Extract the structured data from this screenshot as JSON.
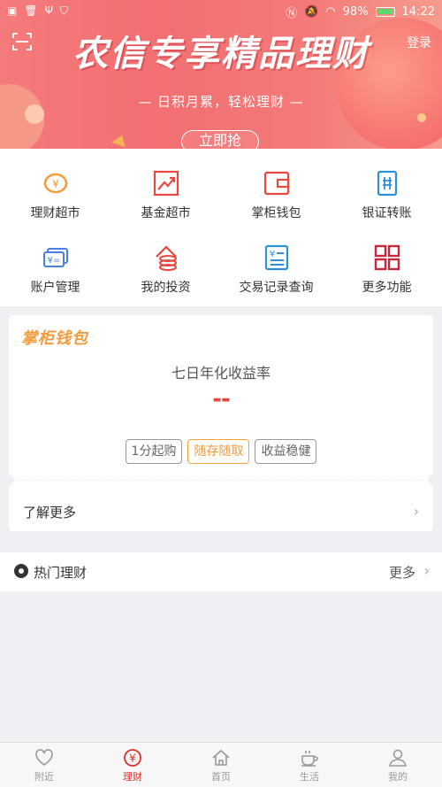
{
  "status": {
    "icons_left": [
      "notify-icon",
      "trash-icon",
      "usb-icon",
      "shield-icon"
    ],
    "battery": "98%",
    "time": "14:22"
  },
  "banner": {
    "title": "农信专享精品理财",
    "subtitle": "— 日积月累，轻松理财 —",
    "button": "立即抢",
    "login": "登录"
  },
  "grid": {
    "items": [
      {
        "label": "理财超市",
        "icon": "piggy-bank-icon"
      },
      {
        "label": "基金超市",
        "icon": "trend-chart-icon"
      },
      {
        "label": "掌柜钱包",
        "icon": "wallet-icon"
      },
      {
        "label": "银证转账",
        "icon": "transfer-ticket-icon"
      },
      {
        "label": "账户管理",
        "icon": "card-icon"
      },
      {
        "label": "我的投资",
        "icon": "coins-icon"
      },
      {
        "label": "交易记录查询",
        "icon": "record-icon"
      },
      {
        "label": "更多功能",
        "icon": "grid-icon"
      }
    ]
  },
  "wallet_card": {
    "logo": "掌柜钱包",
    "rate_label": "七日年化收益率",
    "rate_value": "--",
    "tags": [
      "1分起购",
      "随存随取",
      "收益稳健"
    ],
    "learn_more": "了解更多"
  },
  "hot": {
    "title": "热门理财",
    "more": "更多"
  },
  "tabbar": {
    "tabs": [
      {
        "label": "附近",
        "icon": "heart-icon",
        "active": false
      },
      {
        "label": "理财",
        "icon": "yuan-icon",
        "active": true
      },
      {
        "label": "首页",
        "icon": "home-icon",
        "active": false
      },
      {
        "label": "生活",
        "icon": "coffee-icon",
        "active": false
      },
      {
        "label": "我的",
        "icon": "user-icon",
        "active": false
      }
    ]
  },
  "colors": {
    "brand_red": "#d9302b",
    "accent_orange": "#f39a3b"
  }
}
